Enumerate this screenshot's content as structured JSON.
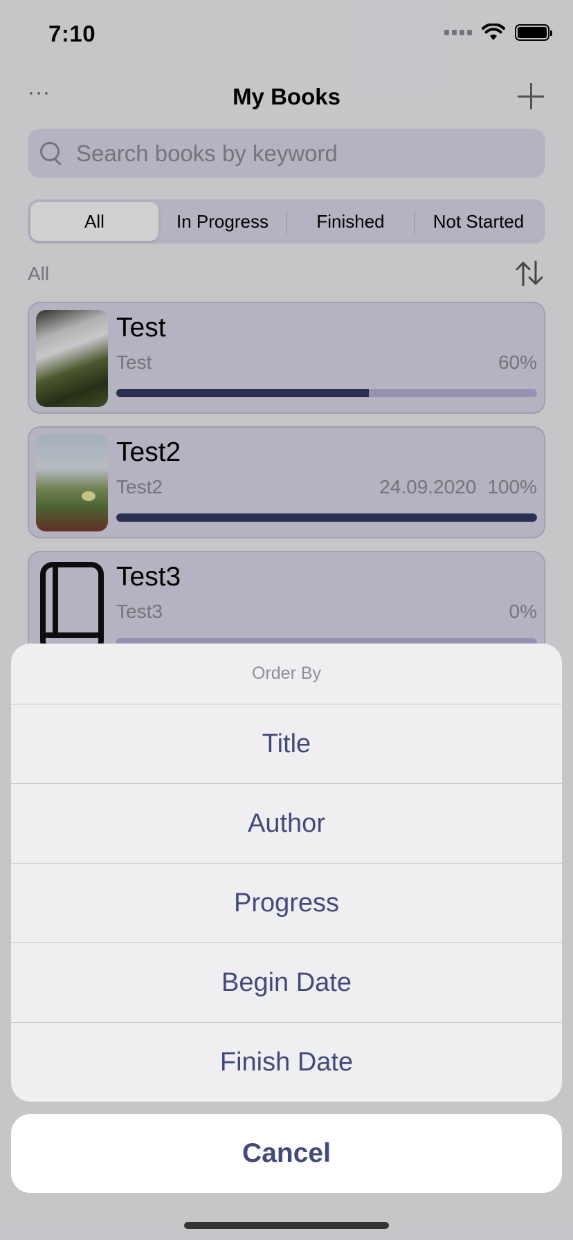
{
  "status_bar": {
    "time": "7:10"
  },
  "nav": {
    "more_label": "···",
    "title": "My Books"
  },
  "search": {
    "placeholder": "Search books by keyword"
  },
  "filters": [
    {
      "label": "All",
      "active": true
    },
    {
      "label": "In Progress",
      "active": false
    },
    {
      "label": "Finished",
      "active": false
    },
    {
      "label": "Not Started",
      "active": false
    }
  ],
  "section": {
    "label": "All"
  },
  "books": [
    {
      "title": "Test",
      "author": "Test",
      "date": "",
      "progress_label": "60%",
      "progress": 0.6,
      "cover": "waterfall"
    },
    {
      "title": "Test2",
      "author": "Test2",
      "date": "24.09.2020",
      "progress_label": "100%",
      "progress": 1.0,
      "cover": "flower"
    },
    {
      "title": "Test3",
      "author": "Test3",
      "date": "",
      "progress_label": "0%",
      "progress": 0.0,
      "cover": "book-icon"
    }
  ],
  "action_sheet": {
    "title": "Order By",
    "options": [
      "Title",
      "Author",
      "Progress",
      "Begin Date",
      "Finish Date"
    ],
    "cancel_label": "Cancel"
  },
  "colors": {
    "accent": "#434a7a",
    "progress_fill": "#353a63",
    "progress_track": "#b8b2d8",
    "card_bg": "#ddd9ec"
  }
}
